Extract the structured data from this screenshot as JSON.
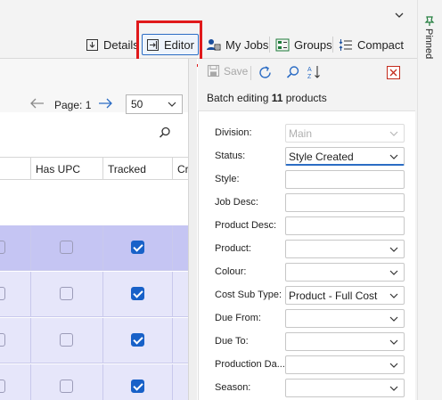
{
  "toolbar": {
    "details_label": "Details",
    "editor_label": "Editor",
    "my_jobs_label": "My Jobs",
    "groups_label": "Groups",
    "compact_label": "Compact"
  },
  "pinned_label": "Pinned",
  "grid": {
    "page_label": "Page: 1",
    "page_size": "50",
    "columns": [
      "",
      "Has UPC",
      "Tracked",
      "Cr"
    ],
    "rows": [
      {
        "has_upc": false,
        "tracked": true,
        "selected": true
      },
      {
        "has_upc": false,
        "tracked": true,
        "selected": false
      },
      {
        "has_upc": false,
        "tracked": true,
        "selected": false
      },
      {
        "has_upc": false,
        "tracked": true,
        "selected": false
      }
    ]
  },
  "editor": {
    "save_label": "Save",
    "batch_prefix": "Batch editing ",
    "batch_count": "11",
    "batch_suffix": " products",
    "fields": [
      {
        "label": "Division:",
        "value": "Main",
        "kind": "dropdown",
        "state": "disabled"
      },
      {
        "label": "Status:",
        "value": "Style Created",
        "kind": "dropdown",
        "state": "focused"
      },
      {
        "label": "Style:",
        "value": "",
        "kind": "text",
        "state": "normal"
      },
      {
        "label": "Job Desc:",
        "value": "",
        "kind": "text",
        "state": "normal"
      },
      {
        "label": "Product Desc:",
        "value": "",
        "kind": "text",
        "state": "normal"
      },
      {
        "label": "Product:",
        "value": "",
        "kind": "dropdown",
        "state": "normal"
      },
      {
        "label": "Colour:",
        "value": "",
        "kind": "dropdown",
        "state": "normal"
      },
      {
        "label": "Cost Sub Type:",
        "value": "Product - Full Cost",
        "kind": "dropdown",
        "state": "normal"
      },
      {
        "label": "Due From:",
        "value": "",
        "kind": "dropdown",
        "state": "normal"
      },
      {
        "label": "Due To:",
        "value": "",
        "kind": "dropdown",
        "state": "normal"
      },
      {
        "label": "Production Da...",
        "value": "",
        "kind": "dropdown",
        "state": "normal"
      },
      {
        "label": "Season:",
        "value": "",
        "kind": "dropdown",
        "state": "normal"
      }
    ]
  },
  "colors": {
    "accent": "#2b6cc4",
    "highlight": "#e0191b",
    "selected_row": "#c5c5f3",
    "row": "#e6e6fa"
  }
}
